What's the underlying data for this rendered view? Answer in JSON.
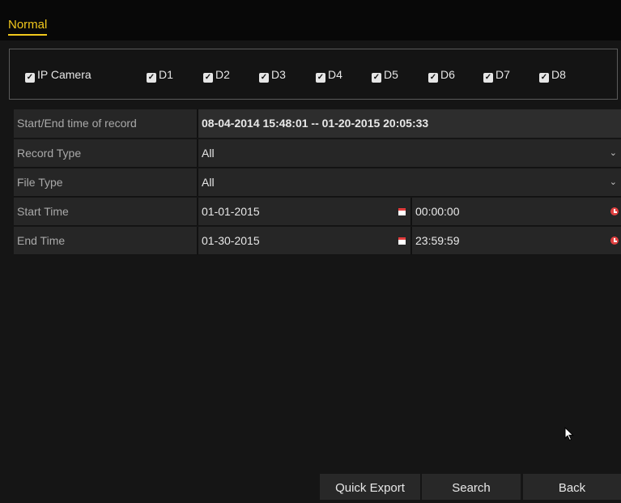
{
  "tabs": {
    "normal": "Normal"
  },
  "cameras": {
    "group_label": "IP Camera",
    "items": [
      "D1",
      "D2",
      "D3",
      "D4",
      "D5",
      "D6",
      "D7",
      "D8"
    ]
  },
  "record_range": {
    "label": "Start/End time of record",
    "value": "08-04-2014 15:48:01 -- 01-20-2015 20:05:33"
  },
  "record_type": {
    "label": "Record Type",
    "value": "All"
  },
  "file_type": {
    "label": "File Type",
    "value": "All"
  },
  "start_time": {
    "label": "Start Time",
    "date": "01-01-2015",
    "time": "00:00:00"
  },
  "end_time": {
    "label": "End Time",
    "date": "01-30-2015",
    "time": "23:59:59"
  },
  "buttons": {
    "quick_export": "Quick Export",
    "search": "Search",
    "back": "Back"
  },
  "icons": {
    "calendar": "calendar-icon",
    "clock": "clock-icon",
    "dropdown": "chevron-down-icon",
    "checkbox": "checkbox-checked-icon"
  },
  "colors": {
    "accent": "#f2c81c",
    "alert_icon": "#e23b3b"
  }
}
